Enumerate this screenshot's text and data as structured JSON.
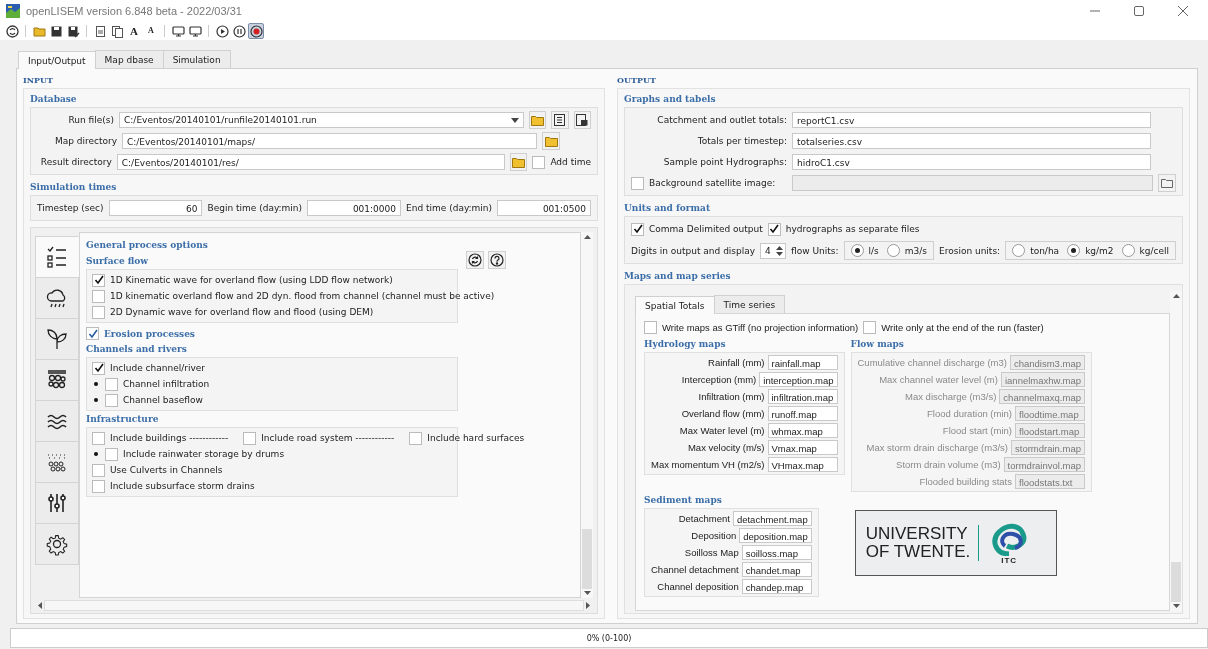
{
  "window": {
    "title": "openLISEM version 6.848 beta - 2022/03/31"
  },
  "toolbar": [
    {
      "kind": "reset",
      "pressed": false
    },
    {
      "kind": "separator"
    },
    {
      "kind": "open",
      "pressed": false
    },
    {
      "kind": "save",
      "pressed": false
    },
    {
      "kind": "save-as",
      "pressed": false
    },
    {
      "kind": "separator"
    },
    {
      "kind": "doc",
      "pressed": false
    },
    {
      "kind": "docs",
      "pressed": false
    },
    {
      "kind": "font-up",
      "glyph": "A",
      "pressed": false
    },
    {
      "kind": "font-down",
      "glyph": "A",
      "pressed": false
    },
    {
      "kind": "separator"
    },
    {
      "kind": "screen",
      "pressed": false
    },
    {
      "kind": "screen",
      "pressed": false
    },
    {
      "kind": "separator"
    },
    {
      "kind": "run",
      "pressed": false
    },
    {
      "kind": "pause",
      "pressed": false
    },
    {
      "kind": "stop",
      "pressed": true
    }
  ],
  "tabs": [
    {
      "label": "Input/Output",
      "selected": true
    },
    {
      "label": "Map dbase",
      "selected": false
    },
    {
      "label": "Simulation",
      "selected": false
    }
  ],
  "input": {
    "title": "INPUT",
    "database": {
      "title": "Database",
      "run_file": {
        "label": "Run file(s)",
        "value": "C:/Eventos/20140101/runfile20140101.run"
      },
      "map_directory": {
        "label": "Map directory",
        "value": "C:/Eventos/20140101/maps/"
      },
      "result_directory": {
        "label": "Result directory",
        "value": "C:/Eventos/20140101/res/"
      },
      "add_time": {
        "label": "Add time",
        "checked": false
      }
    },
    "simulation_times": {
      "title": "Simulation times",
      "fields": [
        {
          "label": "Timestep (sec)",
          "value": "60"
        },
        {
          "label": "Begin time (day:min)",
          "value": "001:0000"
        },
        {
          "label": "End time (day:min)",
          "value": "001:0500"
        }
      ]
    }
  },
  "options": {
    "side_tabs": [
      {
        "kind": "checklist",
        "selected": true
      },
      {
        "kind": "rain",
        "selected": false
      },
      {
        "kind": "plant",
        "selected": false
      },
      {
        "kind": "soil",
        "selected": false
      },
      {
        "kind": "waves",
        "selected": false
      },
      {
        "kind": "sediment",
        "selected": false
      },
      {
        "kind": "sliders",
        "selected": false
      },
      {
        "kind": "gear",
        "selected": false
      }
    ],
    "title": "General process options",
    "groups": [
      {
        "kind": "box",
        "title": "Surface flow",
        "items": [
          {
            "bullet": false,
            "checks": [
              {
                "label": "1D Kinematic wave for overland flow (using LDD flow network)",
                "checked": true
              }
            ]
          },
          {
            "bullet": false,
            "checks": [
              {
                "label": "1D kinematic overland flow and 2D dyn. flood from channel (channel must be active)",
                "checked": false
              }
            ]
          },
          {
            "bullet": false,
            "checks": [
              {
                "label": "2D Dynamic wave for overland flow and flood (using DEM)",
                "checked": false
              }
            ]
          }
        ]
      },
      {
        "kind": "check",
        "title": "Erosion processes",
        "checked": true
      },
      {
        "kind": "box",
        "title": "Channels and rivers",
        "items": [
          {
            "bullet": false,
            "checks": [
              {
                "label": "Include channel/river",
                "checked": true
              }
            ]
          },
          {
            "bullet": true,
            "checks": [
              {
                "label": "Channel infiltration",
                "checked": false
              }
            ]
          },
          {
            "bullet": true,
            "checks": [
              {
                "label": "Channel baseflow",
                "checked": false
              }
            ]
          }
        ]
      },
      {
        "kind": "box",
        "title": "Infrastructure",
        "items": [
          {
            "bullet": false,
            "checks": [
              {
                "label": "Include buildings ------------",
                "checked": false
              },
              {
                "label": "Include road system ------------",
                "checked": false
              },
              {
                "label": "Include hard surfaces",
                "checked": false
              }
            ]
          },
          {
            "bullet": true,
            "checks": [
              {
                "label": "Include rainwater storage by drums",
                "checked": false
              }
            ]
          },
          {
            "bullet": false,
            "checks": [
              {
                "label": "Use Culverts in Channels",
                "checked": false
              }
            ]
          },
          {
            "bullet": false,
            "checks": [
              {
                "label": "Include subsurface storm drains",
                "checked": false
              }
            ]
          }
        ]
      }
    ]
  },
  "output": {
    "title": "OUTPUT",
    "graphs": {
      "title": "Graphs and tabels",
      "fields": [
        {
          "label": "Catchment and outlet totals:",
          "value": "reportC1.csv"
        },
        {
          "label": "Totals per timestep:",
          "value": "totalseries.csv"
        },
        {
          "label": "Sample point Hydrographs:",
          "value": "hidroC1.csv"
        }
      ],
      "background": {
        "label": "Background satellite image:",
        "checked": false,
        "disabled": true
      }
    },
    "units": {
      "title": "Units and format",
      "checks": [
        {
          "label": "Comma Delimited output",
          "checked": true
        },
        {
          "label": "hydrographs as separate files",
          "checked": true
        }
      ],
      "digits": {
        "label": "Digits in output and display",
        "value": "4"
      },
      "flow_units": {
        "label": "flow Units:",
        "options": [
          {
            "label": "l/s",
            "selected": true
          },
          {
            "label": "m3/s",
            "selected": false
          }
        ]
      },
      "erosion_units": {
        "label": "Erosion units:",
        "options": [
          {
            "label": "ton/ha",
            "selected": false
          },
          {
            "label": "kg/m2",
            "selected": true
          },
          {
            "label": "kg/cell",
            "selected": false
          }
        ]
      }
    },
    "maps": {
      "title": "Maps and map series",
      "tabs": [
        {
          "label": "Spatial Totals",
          "selected": true
        },
        {
          "label": "Time series",
          "selected": false
        }
      ],
      "checks": [
        {
          "label": "Write maps as GTiff (no projection information)",
          "checked": false
        },
        {
          "label": "Write only at the end of the run (faster)",
          "checked": false
        }
      ],
      "hydrology": {
        "title": "Hydrology maps",
        "disabled": false,
        "fields": [
          {
            "label": "Rainfall (mm)",
            "value": "rainfall.map"
          },
          {
            "label": "Interception (mm)",
            "value": "interception.map"
          },
          {
            "label": "Infiltration (mm)",
            "value": "infiltration.map"
          },
          {
            "label": "Overland flow (mm)",
            "value": "runoff.map"
          },
          {
            "label": "Max Water level  (m)",
            "value": "whmax.map"
          },
          {
            "label": "Max velocity (m/s)",
            "value": "Vmax.map"
          },
          {
            "label": "Max momentum VH (m2/s)",
            "value": "VHmax.map"
          }
        ]
      },
      "flow": {
        "title": "Flow maps",
        "disabled": true,
        "fields": [
          {
            "label": "Cumulative channel discharge (m3)",
            "value": "chandism3.map"
          },
          {
            "label": "Max channel water level (m)",
            "value": "iannelmaxhw.map"
          },
          {
            "label": "Max discharge (m3/s)",
            "value": "channelmaxq.map"
          },
          {
            "label": "Flood duration (min)",
            "value": "floodtime.map"
          },
          {
            "label": "Flood start (min)",
            "value": "floodstart.map"
          },
          {
            "label": "Max storm drain discharge (m3/s)",
            "value": "stormdrain.map"
          },
          {
            "label": "Storm drain volume (m3)",
            "value": "tormdrainvol.map"
          },
          {
            "label": "Flooded building stats",
            "value": "floodstats.txt"
          }
        ]
      },
      "sediment": {
        "title": "Sediment maps",
        "disabled": false,
        "fields": [
          {
            "label": "Detachment",
            "value": "detachment.map"
          },
          {
            "label": "Deposition",
            "value": "deposition.map"
          },
          {
            "label": "Soilloss Map",
            "value": "soilloss.map"
          },
          {
            "label": "Channel detachment",
            "value": "chandet.map"
          },
          {
            "label": "Channel deposition",
            "value": "chandep.map"
          }
        ]
      },
      "logo": {
        "line1": "UNIVERSITY",
        "line2": "OF TWENTE.",
        "mark": "ITC"
      }
    }
  },
  "status_bar": {
    "progress": "0% (0-100)"
  }
}
